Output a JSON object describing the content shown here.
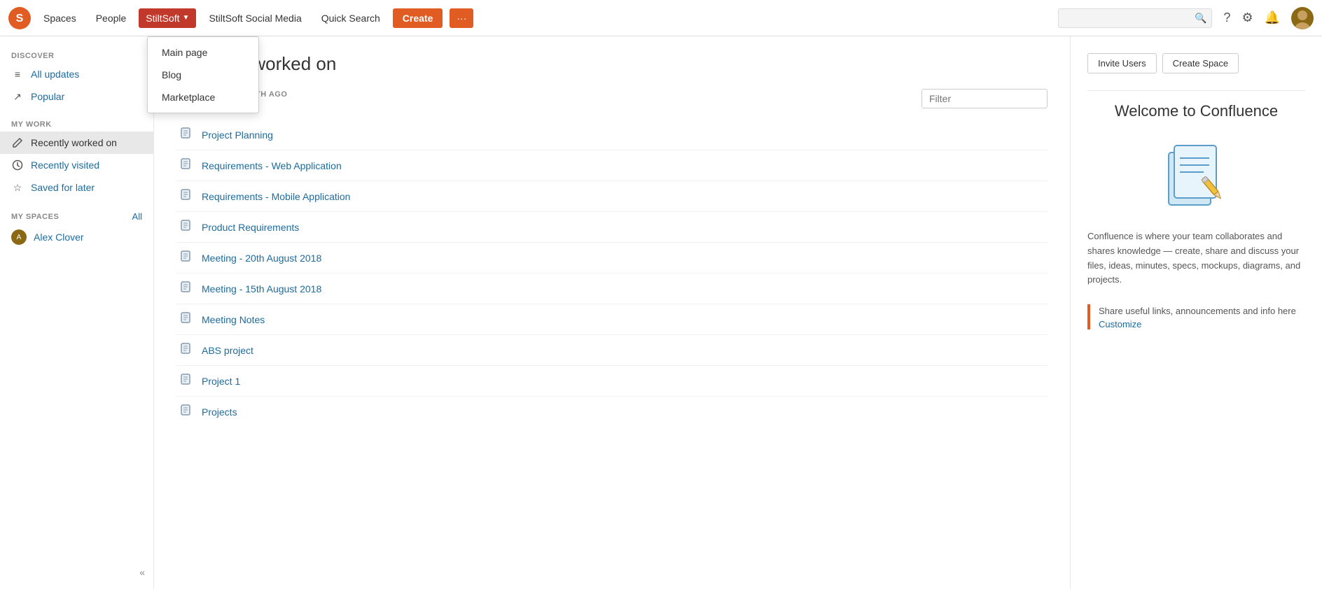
{
  "header": {
    "logo_alt": "StiltSoft Logo",
    "nav": {
      "spaces": "Spaces",
      "people": "People",
      "stilsoft": "StiltSoft",
      "stilsoft_social": "StiltSoft Social Media",
      "quick_search": "Quick Search",
      "create": "Create",
      "more": "···"
    },
    "search_placeholder": "",
    "dropdown": {
      "main_page": "Main page",
      "blog": "Blog",
      "marketplace": "Marketplace"
    }
  },
  "sidebar": {
    "discover_label": "DISCOVER",
    "items_discover": [
      {
        "id": "all-updates",
        "label": "All updates",
        "icon": "≡"
      },
      {
        "id": "popular",
        "label": "Popular",
        "icon": "↗"
      }
    ],
    "my_work_label": "MY WORK",
    "items_work": [
      {
        "id": "recently-worked-on",
        "label": "Recently worked on",
        "icon": "✏",
        "active": true
      },
      {
        "id": "recently-visited",
        "label": "Recently visited",
        "icon": "🕐"
      },
      {
        "id": "saved-for-later",
        "label": "Saved for later",
        "icon": "☆"
      }
    ],
    "my_spaces_label": "MY SPACES",
    "all_link": "All",
    "spaces": [
      {
        "id": "alex-clover",
        "label": "Alex Clover",
        "initials": "A"
      }
    ],
    "collapse_label": "«"
  },
  "main": {
    "title": "Recently worked on",
    "filter_placeholder": "Filter",
    "section_label": "MORE THAN A MONTH AGO",
    "items": [
      {
        "id": 1,
        "label": "Project Planning"
      },
      {
        "id": 2,
        "label": "Requirements - Web Application"
      },
      {
        "id": 3,
        "label": "Requirements - Mobile Application"
      },
      {
        "id": 4,
        "label": "Product Requirements"
      },
      {
        "id": 5,
        "label": "Meeting - 20th August 2018"
      },
      {
        "id": 6,
        "label": "Meeting - 15th August 2018"
      },
      {
        "id": 7,
        "label": "Meeting Notes"
      },
      {
        "id": 8,
        "label": "ABS project"
      },
      {
        "id": 9,
        "label": "Project 1"
      },
      {
        "id": 10,
        "label": "Projects"
      }
    ]
  },
  "right_panel": {
    "invite_users": "Invite Users",
    "create_space": "Create Space",
    "welcome_title": "Welcome to Confluence",
    "welcome_desc": "Confluence is where your team collaborates and shares knowledge — create, share and discuss your files, ideas, minutes, specs, mockups, diagrams, and projects.",
    "share_text": "Share useful links, announcements and info here",
    "customize_link": "Customize"
  }
}
